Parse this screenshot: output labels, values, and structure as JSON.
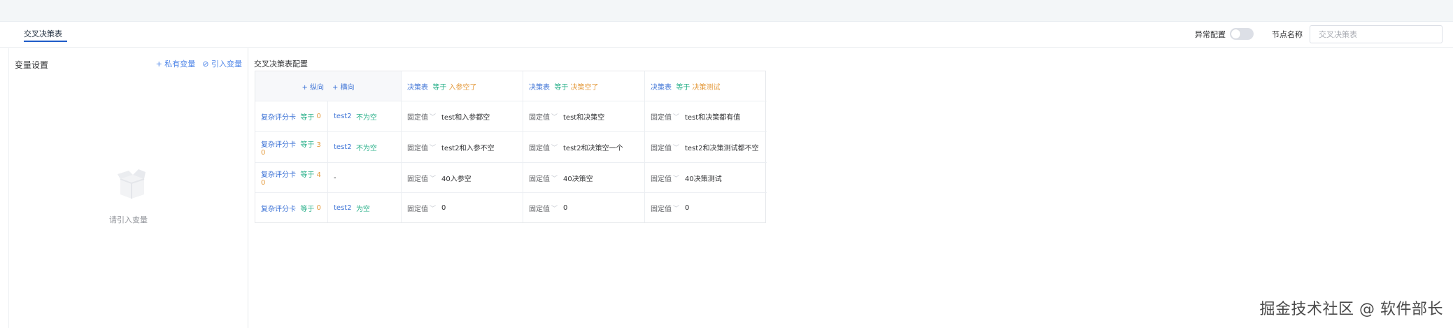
{
  "header": {
    "tab_label": "交叉决策表",
    "exception_label": "异常配置",
    "node_name_label": "节点名称",
    "node_name_value": "交叉决策表"
  },
  "left_panel": {
    "title": "变量设置",
    "private_var_label": "+ 私有变量",
    "import_var_label": "⊘ 引入变量",
    "empty_text": "请引入变量"
  },
  "main": {
    "title": "交叉决策表配置",
    "corner": {
      "vertical": "+ 纵向",
      "horizontal": "+ 横向"
    },
    "columns": [
      {
        "var": "决策表",
        "op": "等于",
        "val": "入参空了"
      },
      {
        "var": "决策表",
        "op": "等于",
        "val": "决策空了"
      },
      {
        "var": "决策表",
        "op": "等于",
        "val": "决策测试"
      }
    ],
    "rows": [
      {
        "var": "复杂评分卡",
        "op": "等于",
        "num": "0",
        "num2": "",
        "sub": "test2",
        "subop": "不为空",
        "cells": [
          {
            "type": "固定值",
            "value": "test和入参都空"
          },
          {
            "type": "固定值",
            "value": "test和决策空"
          },
          {
            "type": "固定值",
            "value": "test和决策都有值"
          }
        ]
      },
      {
        "var": "复杂评分卡",
        "op": "等于",
        "num": "3",
        "num2": "0",
        "sub": "test2",
        "subop": "不为空",
        "cells": [
          {
            "type": "固定值",
            "value": "test2和入参不空"
          },
          {
            "type": "固定值",
            "value": "test2和决策空一个"
          },
          {
            "type": "固定值",
            "value": "test2和决策测试都不空"
          }
        ]
      },
      {
        "var": "复杂评分卡",
        "op": "等于",
        "num": "4",
        "num2": "0",
        "sub": "-",
        "subop": "",
        "cells": [
          {
            "type": "固定值",
            "value": "40入参空"
          },
          {
            "type": "固定值",
            "value": "40决策空"
          },
          {
            "type": "固定值",
            "value": "40决策测试"
          }
        ]
      },
      {
        "var": "复杂评分卡",
        "op": "等于",
        "num": "0",
        "num2": "",
        "sub": "test2",
        "subop": "为空",
        "cells": [
          {
            "type": "固定值",
            "value": "0"
          },
          {
            "type": "固定值",
            "value": "0"
          },
          {
            "type": "固定值",
            "value": "0"
          }
        ]
      }
    ]
  },
  "watermark": "掘金技术社区 @ 软件部长",
  "colors": {
    "accent": "#3d73d6",
    "green": "#29b08a",
    "orange": "#e49a3c"
  }
}
